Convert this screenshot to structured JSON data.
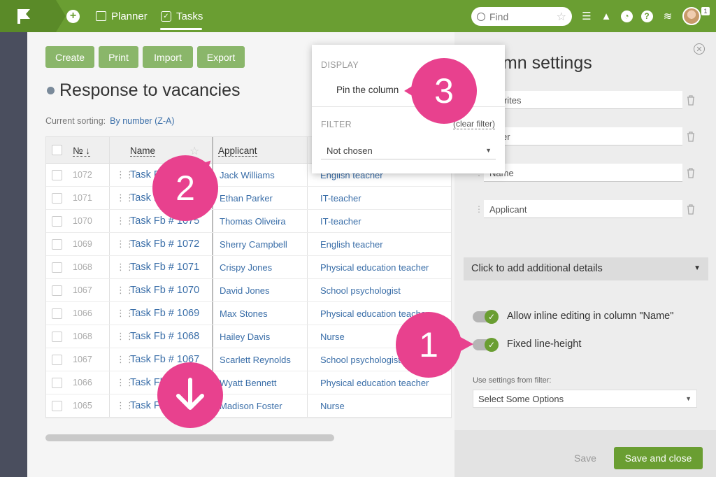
{
  "topbar": {
    "nav": [
      {
        "label": "Planner",
        "icon": "planner-icon"
      },
      {
        "label": "Tasks",
        "icon": "tasks-icon"
      }
    ],
    "search_placeholder": "Find",
    "avatar_badge": "1",
    "accent": "#6a9e32"
  },
  "toolbar": {
    "create": "Create",
    "print": "Print",
    "import": "Import",
    "export": "Export"
  },
  "page": {
    "title": "Response to vacancies",
    "sorting_label": "Current sorting:",
    "sorting_value": "By number (Z-A)"
  },
  "table": {
    "headers": {
      "num": "№",
      "name": "Name",
      "applicant": "Applicant"
    },
    "rows": [
      {
        "num": "1072",
        "name": "Task F",
        "applicant": "Jack Williams",
        "vacancy": "English teacher"
      },
      {
        "num": "1071",
        "name": "Task F",
        "applicant": "Ethan Parker",
        "vacancy": "IT-teacher"
      },
      {
        "num": "1070",
        "name": "Task Fb # 1075",
        "applicant": "Thomas Oliveira",
        "vacancy": "IT-teacher"
      },
      {
        "num": "1069",
        "name": "Task Fb # 1072",
        "applicant": "Sherry Campbell",
        "vacancy": "English teacher"
      },
      {
        "num": "1068",
        "name": "Task Fb # 1071",
        "applicant": "Crispy Jones",
        "vacancy": "Physical education teacher"
      },
      {
        "num": "1067",
        "name": "Task Fb # 1070",
        "applicant": "David Jones",
        "vacancy": "School psychologist"
      },
      {
        "num": "1066",
        "name": "Task Fb # 1069",
        "applicant": "Max Stones",
        "vacancy": "Physical education teacher"
      },
      {
        "num": "1068",
        "name": "Task Fb # 1068",
        "applicant": "Hailey Davis",
        "vacancy": "Nurse"
      },
      {
        "num": "1067",
        "name": "Task Fb # 1067",
        "applicant": "Scarlett Reynolds",
        "vacancy": "School psychologist"
      },
      {
        "num": "1066",
        "name": "Task Fl",
        "applicant": "Wyatt Bennett",
        "vacancy": "Physical education teacher"
      },
      {
        "num": "1065",
        "name": "Task Fl",
        "applicant": "Madison Foster",
        "vacancy": "Nurse"
      }
    ]
  },
  "popup": {
    "display_heading": "DISPLAY",
    "pin_label": "Pin the column",
    "filter_heading": "FILTER",
    "clear_filter": "clear filter",
    "filter_value": "Not chosen"
  },
  "panel": {
    "title": "umn settings",
    "fields": [
      "avorites",
      "mber",
      "Name",
      "Applicant"
    ],
    "details": "Click to add additional details",
    "toggle_inline": "Allow inline editing in column \"Name\"",
    "toggle_fixed": "Fixed line-height",
    "filter_label": "Use settings from filter:",
    "filter_select": "Select Some Options",
    "save": "Save",
    "save_close": "Save and close"
  },
  "badges": {
    "one": "1",
    "two": "2",
    "three": "3",
    "badge_color": "#e8418e"
  }
}
